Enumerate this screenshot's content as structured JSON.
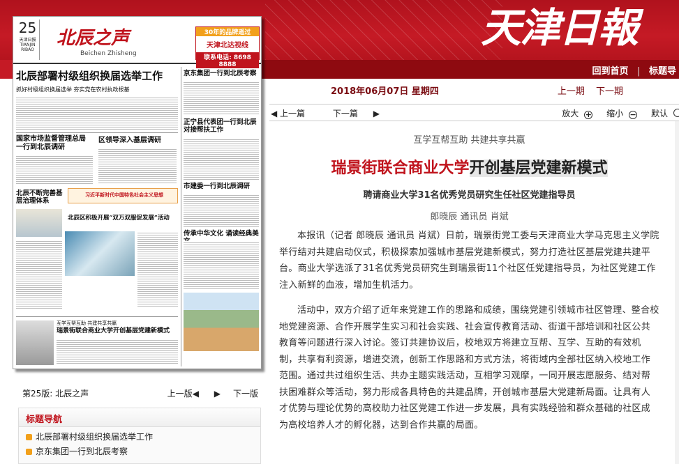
{
  "masthead": {
    "title": "天津日報"
  },
  "nav": {
    "home": "回到首页",
    "separator": "|",
    "headlines": "标题导"
  },
  "date": {
    "text": "2018年06月07日 星期四"
  },
  "issues": {
    "prev": "上一期",
    "next": "下一期"
  },
  "thumbnail": {
    "page_no": "25",
    "page_paper": "天津日报",
    "page_paper_en": "TIANJIN RIBAO",
    "name": "北辰之声",
    "name_en": "Beichen Zhisheng",
    "ad_line1": "30年的品牌遥过",
    "ad_line2": "天津北达视线",
    "ad_line3": "联系电话: 8698 8888",
    "headline_main": "北辰部署村级组织换届选举工作",
    "headline_main_sub": "抓好村级组织换届选举 夯实党在农村执政根基",
    "headline_right1": "京东集团一行到北辰考察",
    "headline_market": "国家市场监督管理总局一行到北辰调研",
    "headline_district": "区领导深入基层调研",
    "headline_zhengning": "正宁县代表团一行到北辰对接帮扶工作",
    "headline_reform": "北辰不断完善基层治理体系",
    "headline_banner": "习近平新时代中国特色社会主义思想",
    "headline_city": "市建委一行到北辰调研",
    "headline_double": "北辰区积极开展“双万双服促发展”活动",
    "headline_culture": "传承中华文化 诵读经典美文",
    "headline_bottom": "瑞景街联合商业大学开创基层党建新模式",
    "headline_bottom_kicker": "互学互帮互助 共建共享共赢"
  },
  "page_info": {
    "label": "第25版: 北辰之声",
    "prev": "上一版",
    "next": "下一版"
  },
  "headline_nav": {
    "title": "标题导航",
    "items": [
      "北辰部署村级组织换届选举工作",
      "京东集团一行到北辰考察"
    ]
  },
  "toolbar": {
    "prev": "上一篇",
    "next": "下一篇",
    "zoom_in": "放大",
    "zoom_out": "缩小",
    "restore": "默认"
  },
  "article": {
    "kicker": "互学互帮互助 共建共享共赢",
    "title_main": "瑞景街联合商业大学",
    "title_highlight": "开创基层党建新模式",
    "subtitle": "聘请商业大学31名优秀党员研究生任社区党建指导员",
    "byline": "郎晓辰 通讯员 肖斌",
    "paragraphs": [
      "本报讯（记者 郎晓辰 通讯员 肖斌）日前，瑞景街党工委与天津商业大学马克思主义学院举行结对共建启动仪式，积极探索加强城市基层党建新模式，努力打造社区基层党建共建平台。商业大学选派了31名优秀党员研究生到瑞景街11个社区任党建指导员，为社区党建工作注入新鲜的血液，增加生机活力。",
      "活动中，双方介绍了近年来党建工作的思路和成绩，围绕党建引领城市社区管理、整合校地党建资源、合作开展学生实习和社会实践、社会宣传教育活动、街道干部培训和社区公共教育等问题进行深入讨论。签订共建协议后，校地双方将建立互帮、互学、互助的有效机制，共享有利资源，增进交流，创新工作思路和方式方法，将街域内全部社区纳入校地工作范围。通过共过组织生活、共办主题实践活动，互相学习观摩，一同开展志愿服务、结对帮扶困难群众等活动，努力形成各具特色的共建品牌，开创城市基层大党建新局面。让具有人才优势与理论优势的高校助力社区党建工作进一步发展，具有实践经验和群众基础的社区成为高校培养人才的孵化器，达到合作共赢的局面。"
    ]
  },
  "colors": {
    "brand_red": "#c51a25",
    "dark_red": "#8e0a10",
    "title_red": "#c0141d",
    "accent_orange": "#f2a01b"
  }
}
